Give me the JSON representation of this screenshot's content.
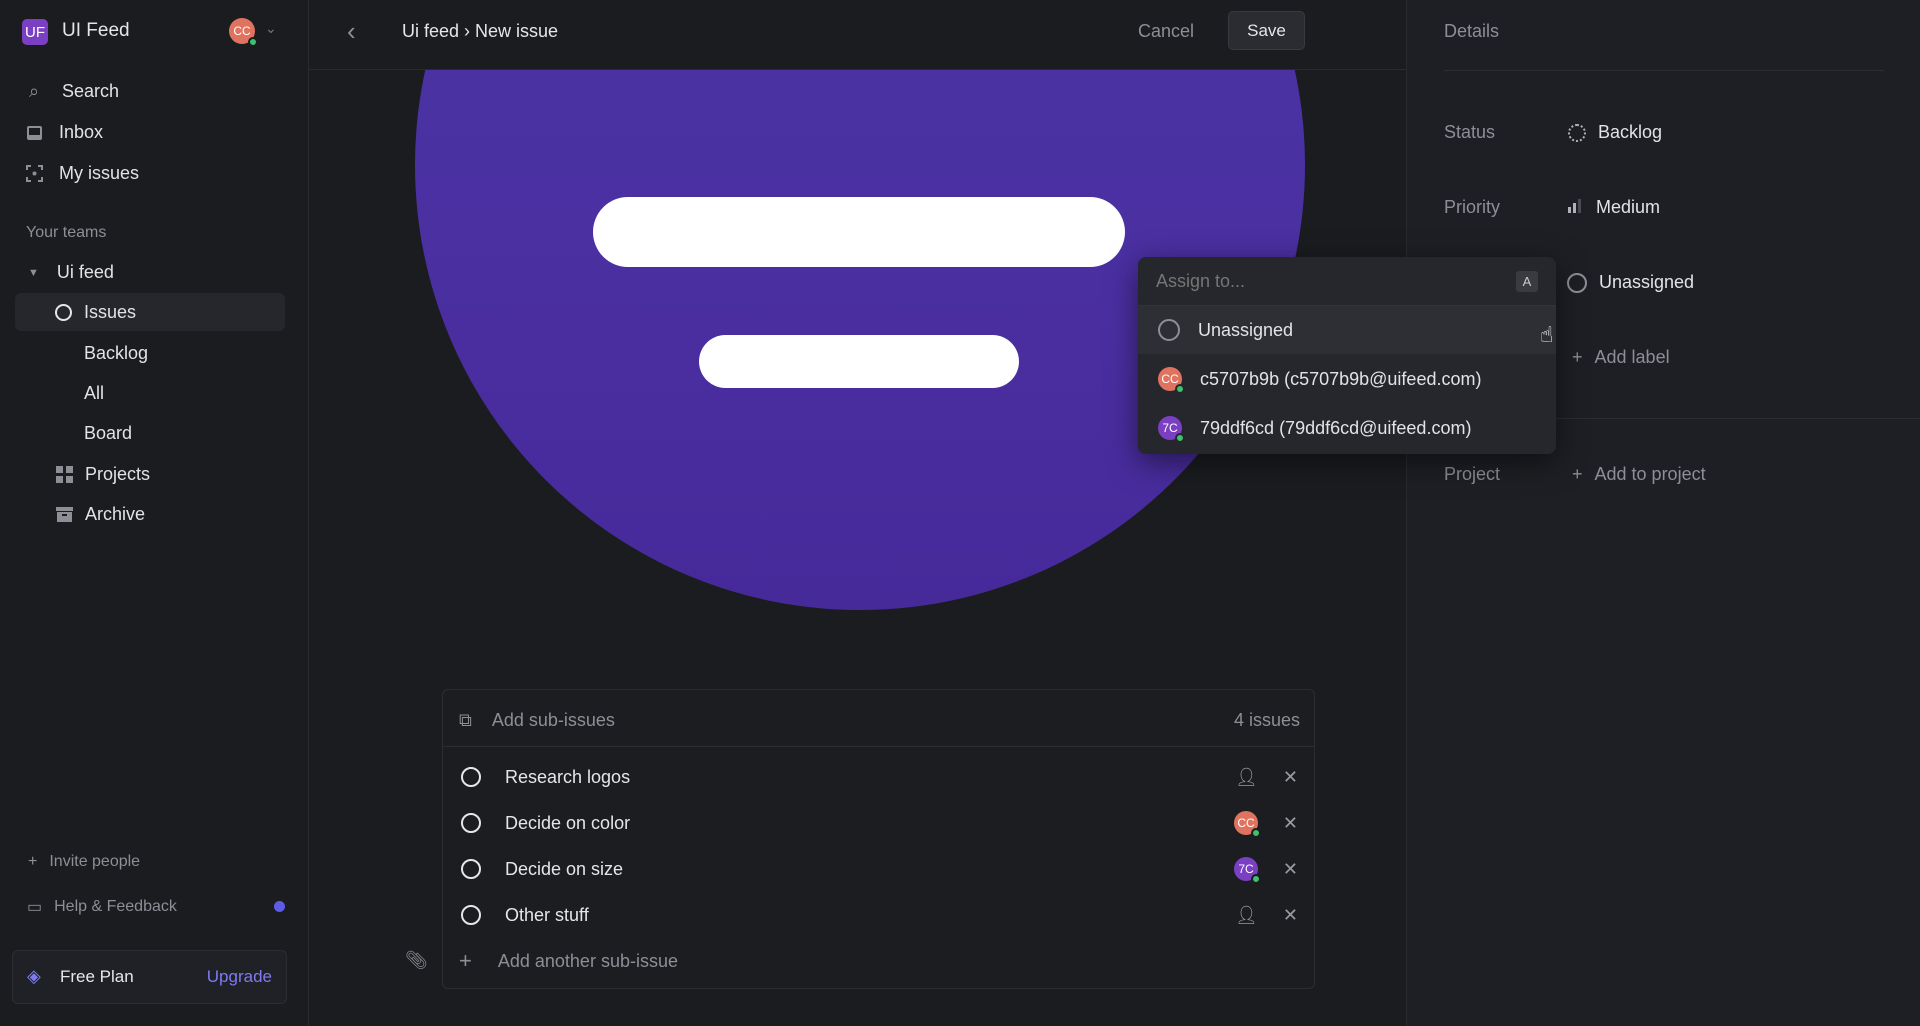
{
  "workspace": {
    "initials": "UF",
    "name": "UI Feed",
    "user_initials": "CC"
  },
  "sidebar": {
    "nav": [
      {
        "label": "Search",
        "icon": "search-icon"
      },
      {
        "label": "Inbox",
        "icon": "inbox-icon"
      },
      {
        "label": "My issues",
        "icon": "my-issues-icon"
      }
    ],
    "teams_heading": "Your teams",
    "team": {
      "name": "Ui feed",
      "items": [
        {
          "label": "Issues"
        },
        {
          "label": "Backlog"
        },
        {
          "label": "All"
        },
        {
          "label": "Board"
        },
        {
          "label": "Projects"
        },
        {
          "label": "Archive"
        }
      ]
    },
    "invite": "Invite people",
    "help": "Help & Feedback",
    "plan": {
      "label": "Free Plan",
      "upgrade": "Upgrade"
    }
  },
  "header": {
    "breadcrumb": "Ui feed › New issue",
    "cancel": "Cancel",
    "save": "Save"
  },
  "details": {
    "title": "Details",
    "status": {
      "label": "Status",
      "value": "Backlog"
    },
    "priority": {
      "label": "Priority",
      "value": "Medium"
    },
    "assignee": {
      "value": "Unassigned"
    },
    "labels": {
      "add": "Add label"
    },
    "project": {
      "label": "Project",
      "add": "Add to project"
    }
  },
  "assign_menu": {
    "placeholder": "Assign to...",
    "shortcut": "A",
    "options": [
      {
        "label": "Unassigned"
      },
      {
        "label": "c5707b9b (c5707b9b@uifeed.com)",
        "initials": "CC",
        "color": "#e0735f"
      },
      {
        "label": "79ddf6cd (79ddf6cd@uifeed.com)",
        "initials": "7C",
        "color": "#7b3fc4"
      }
    ]
  },
  "sub_issues": {
    "header": "Add sub-issues",
    "count": "4 issues",
    "items": [
      {
        "title": "Research logos",
        "assignee": null
      },
      {
        "title": "Decide on color",
        "assignee": "CC",
        "color": "#e0735f"
      },
      {
        "title": "Decide on size",
        "assignee": "7C",
        "color": "#7b3fc4"
      },
      {
        "title": "Other stuff",
        "assignee": null
      }
    ],
    "add_another": "Add another sub-issue"
  },
  "colors": {
    "accent": "#5e5ce6",
    "logo_bg": "#4a33a8",
    "brand_purple": "#7b3fc4"
  }
}
